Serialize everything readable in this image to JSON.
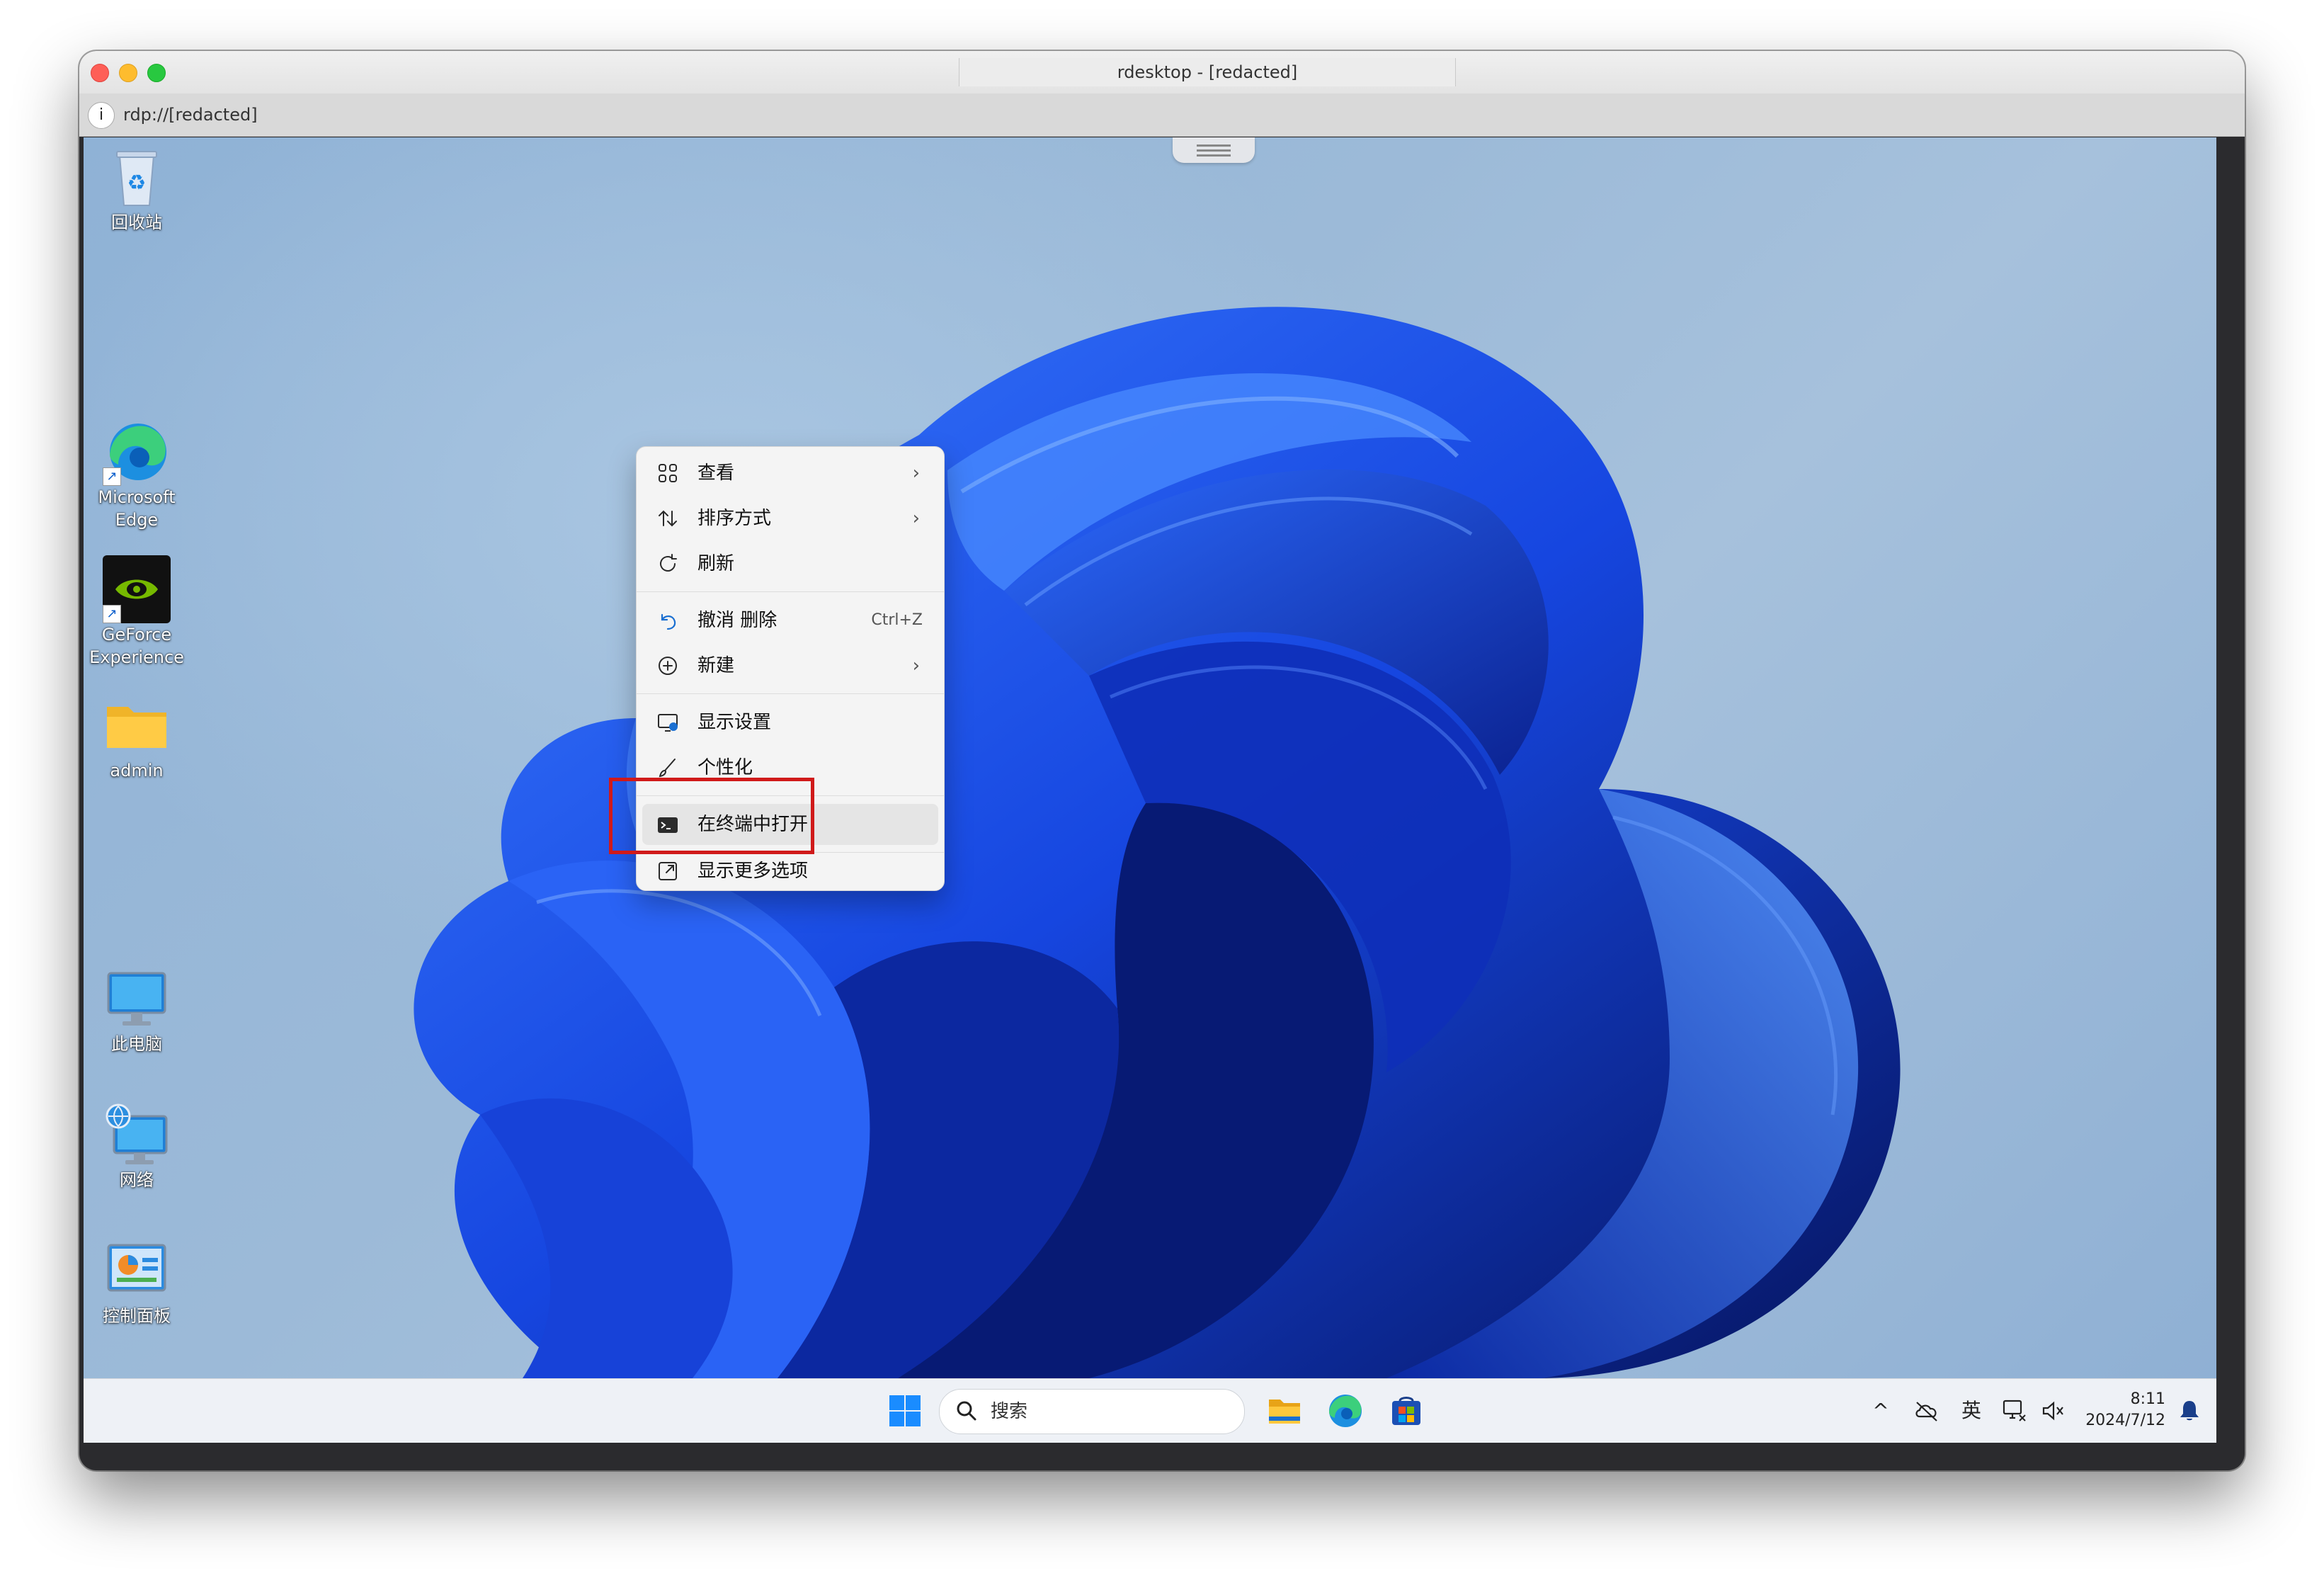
{
  "window": {
    "title": "rdesktop - [redacted]",
    "address": "rdp://[redacted]"
  },
  "desktop_icons": [
    {
      "name": "recycle-bin",
      "label": "回收站"
    },
    {
      "name": "microsoft-edge",
      "label_line1": "Microsoft",
      "label_line2": "Edge"
    },
    {
      "name": "geforce-experience",
      "label_line1": "GeForce",
      "label_line2": "Experience"
    },
    {
      "name": "admin-folder",
      "label": "admin"
    },
    {
      "name": "this-pc",
      "label": "此电脑"
    },
    {
      "name": "network",
      "label": "网络"
    },
    {
      "name": "control-panel",
      "label": "控制面板"
    }
  ],
  "context_menu": {
    "items": [
      {
        "label": "查看",
        "icon": "grid-view-icon",
        "submenu": true
      },
      {
        "label": "排序方式",
        "icon": "sort-icon",
        "submenu": true
      },
      {
        "label": "刷新",
        "icon": "refresh-icon",
        "submenu": false
      },
      {
        "label": "撤消 删除",
        "icon": "undo-icon",
        "shortcut": "Ctrl+Z"
      },
      {
        "label": "新建",
        "icon": "new-plus-icon",
        "submenu": true
      },
      {
        "label": "显示设置",
        "icon": "display-settings-icon"
      },
      {
        "label": "个性化",
        "icon": "personalize-brush-icon"
      },
      {
        "label": "在终端中打开",
        "icon": "terminal-icon",
        "highlighted": true
      },
      {
        "label": "显示更多选项",
        "icon": "more-options-icon"
      }
    ],
    "submenu_arrow": "›",
    "highlight_color": "#d01a1a"
  },
  "taskbar": {
    "search_placeholder": "搜索",
    "apps": [
      "start-icon",
      "file-explorer-icon",
      "edge-icon",
      "microsoft-store-icon"
    ],
    "tray": {
      "chevron": "^",
      "ime_label": "英",
      "time": "8:11",
      "date": "2024/7/12"
    }
  },
  "colors": {
    "wallpaper_blue": "#1a4fe0",
    "taskbar_bg": "#eef1f6"
  }
}
